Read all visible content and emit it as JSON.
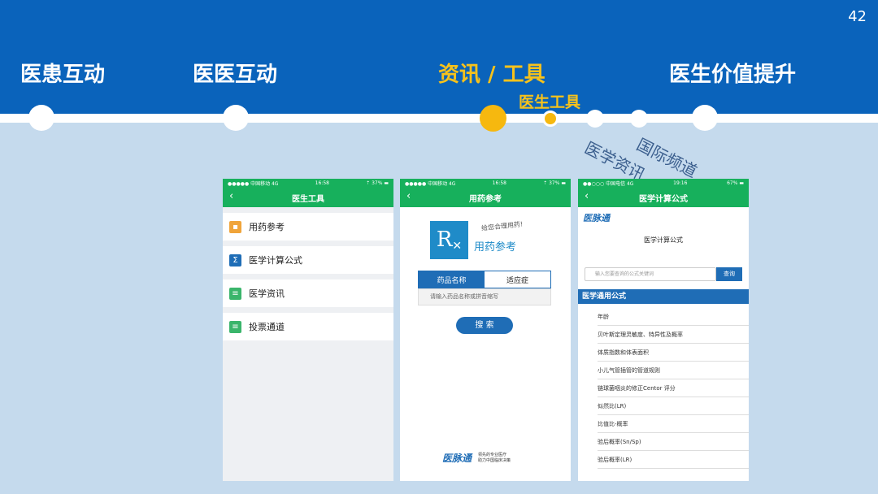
{
  "page_number": "42",
  "nav": {
    "items": [
      {
        "label": "医患互动"
      },
      {
        "label": "医医互动"
      },
      {
        "label": "资讯 / 工具"
      },
      {
        "label": "医生价值提升"
      }
    ],
    "sub_label": "医生工具",
    "slanted_labels": [
      "医学资讯",
      "国际频道"
    ],
    "active_color": "#f6c21c",
    "header_color": "#0a63bb"
  },
  "phone1": {
    "status": {
      "carrier": "●●●●● 中国移动  4G",
      "time": "16:58",
      "battery": "⇡ 37% ▬"
    },
    "title": "医生工具",
    "back": "‹",
    "menu": [
      {
        "label": "用药参考",
        "icon": "pill-box-icon",
        "color": "#f0a43a"
      },
      {
        "label": "医学计算公式",
        "icon": "sigma-icon",
        "color": "#1f6db6"
      },
      {
        "label": "医学资讯",
        "icon": "document-icon",
        "color": "#3ab56b"
      },
      {
        "label": "投票通道",
        "icon": "ballot-icon",
        "color": "#3ab56b"
      }
    ]
  },
  "phone2": {
    "status": {
      "carrier": "●●●●● 中国移动  4G",
      "time": "16:58",
      "battery": "⇡ 37% ▬"
    },
    "title": "用药参考",
    "back": "‹",
    "rx_symbol": "R",
    "slogan": "给您合理用药!",
    "rx_title": "用药参考",
    "tabs": [
      "药品名称",
      "适应症"
    ],
    "input_placeholder": "请输入药品名称或拼音缩写",
    "search_label": "搜 索",
    "brand_logo": "医脉通",
    "brand_tagline": [
      "领先的专业医疗",
      "助力中国临床决策"
    ]
  },
  "phone3": {
    "status": {
      "carrier": "●●○○○ 中国电信  4G",
      "time": "19:16",
      "battery": "67% ▬"
    },
    "title": "医学计算公式",
    "back": "‹",
    "logo": "医脉通",
    "heading": "医学计算公式",
    "search_placeholder": "输入您要查询的公式关键词",
    "search_button": "查询",
    "section": "医学通用公式",
    "formulas": [
      "年龄",
      "贝叶斯定理灵敏度、特异性及概率",
      "体质指数和体表面积",
      "小儿气管插管的管道规则",
      "链球菌咽炎的修正Centor 评分",
      "似然比(LR)",
      "比值比-概率",
      "验后概率(Sn/Sp)",
      "验后概率(LR)"
    ]
  }
}
